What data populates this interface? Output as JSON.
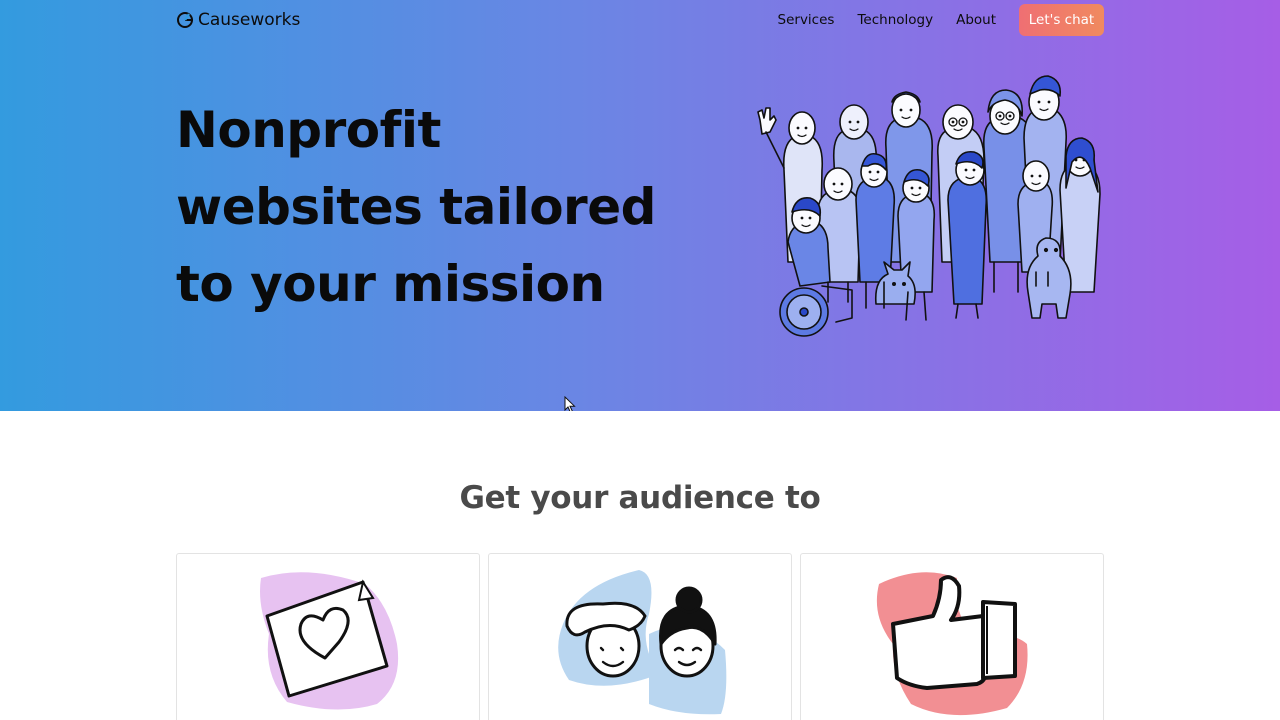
{
  "nav": {
    "logo_text": "Causeworks",
    "links": [
      "Services",
      "Technology",
      "About"
    ],
    "cta_label": "Let's chat"
  },
  "hero": {
    "headline": "Nonprofit websites tailored to your mission"
  },
  "section": {
    "title": "Get your audience to"
  },
  "icons": {
    "logo": "causeworks-c-icon",
    "card1": "heart-card-icon",
    "card2": "two-faces-icon",
    "card3": "thumbs-up-icon",
    "illustration": "diverse-crowd-illustration"
  },
  "colors": {
    "hero_start": "#339bdf",
    "hero_end": "#a65ee6",
    "cta_start": "#ef6f73",
    "cta_end": "#f08a5f",
    "card1_blob": "#e7c2f1",
    "card2_blob": "#b9d6f0",
    "card3_blob": "#f28f93"
  }
}
